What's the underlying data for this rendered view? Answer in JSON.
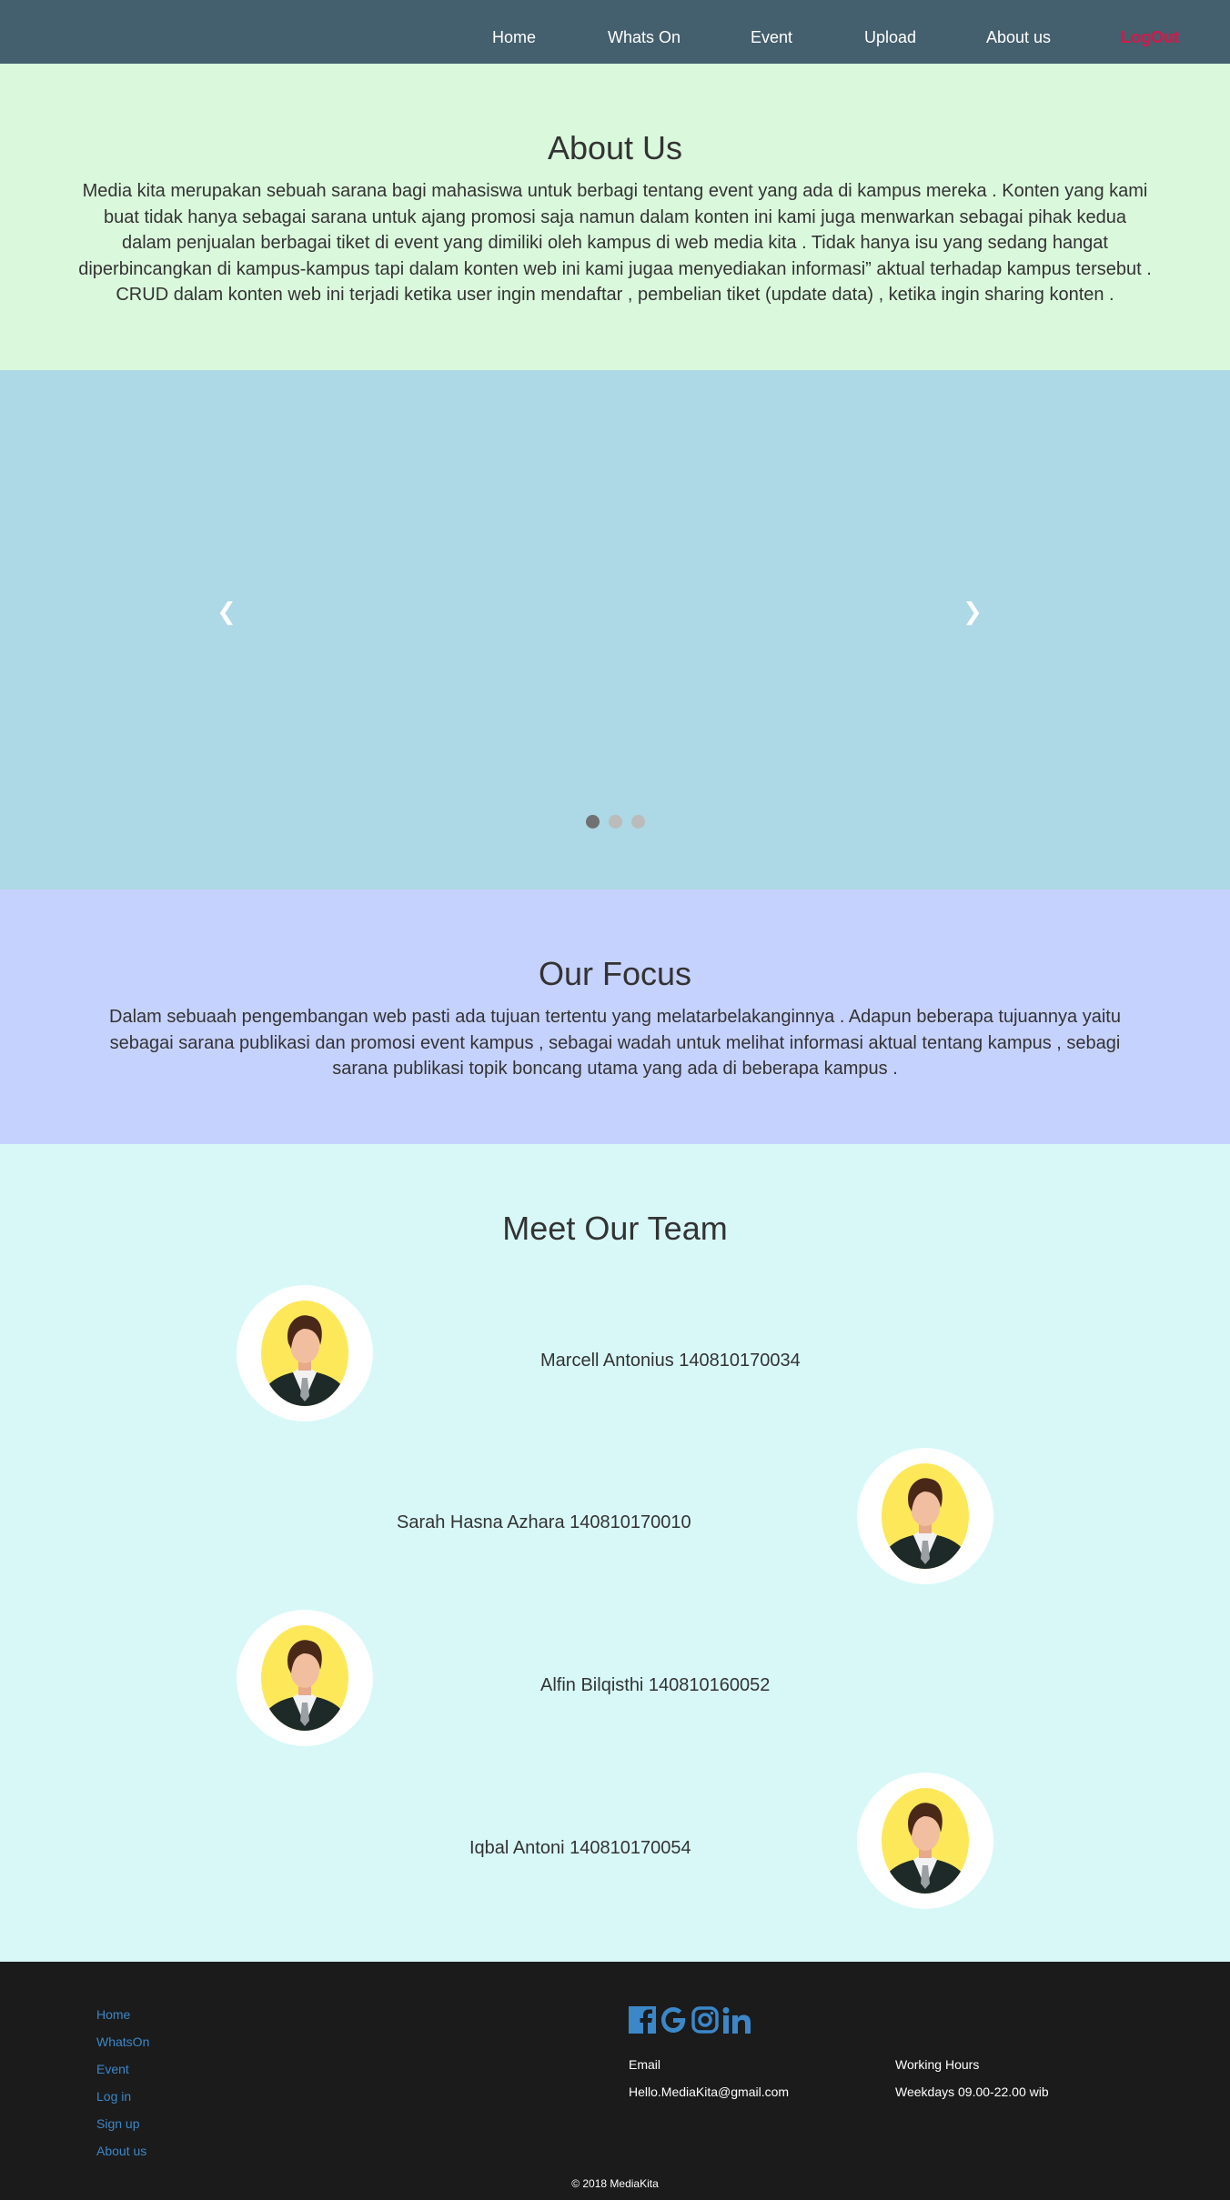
{
  "nav": {
    "home": "Home",
    "whats_on": "Whats On",
    "event": "Event",
    "upload": "Upload",
    "about": "About us",
    "logout": "LogOut"
  },
  "about": {
    "title": "About Us",
    "text": "Media kita merupakan sebuah sarana bagi mahasiswa untuk berbagi tentang event yang ada di kampus mereka . Konten yang kami buat tidak hanya sebagai sarana untuk ajang promosi saja namun dalam konten ini kami juga menwarkan sebagai pihak kedua dalam penjualan berbagai tiket di event yang dimiliki oleh kampus di web media kita . Tidak hanya isu yang sedang hangat diperbincangkan di kampus-kampus tapi dalam konten web ini kami jugaa menyediakan informasi” aktual terhadap kampus tersebut . CRUD dalam konten web ini terjadi ketika user ingin mendaftar , pembelian tiket (update data) , ketika ingin sharing konten ."
  },
  "slider": {
    "prev": "❮",
    "next": "❯",
    "slide_count": 3,
    "active_index": 0
  },
  "focus": {
    "title": "Our Focus",
    "text": "Dalam sebuaah pengembangan web pasti ada tujuan tertentu yang melatarbelakanginnya . Adapun beberapa tujuannya yaitu sebagai sarana publikasi dan promosi event kampus , sebagai wadah untuk melihat informasi aktual tentang kampus , sebagi sarana publikasi topik boncang utama yang ada di beberapa kampus ."
  },
  "team": {
    "title": "Meet Our Team",
    "members": [
      {
        "name": "Marcell Antonius 140810170034"
      },
      {
        "name": "Sarah Hasna Azhara 140810170010"
      },
      {
        "name": "Alfin Bilqisthi 140810160052"
      },
      {
        "name": "Iqbal Antoni 140810170054"
      }
    ]
  },
  "footer": {
    "links": [
      "Home",
      "WhatsOn",
      "Event",
      "Log in",
      "Sign up",
      "About us"
    ],
    "social_icons": [
      "facebook-icon",
      "google-icon",
      "instagram-icon",
      "linkedin-icon"
    ],
    "email_label": "Email",
    "email_value": "Hello.MediaKita@gmail.com",
    "hours_label": "Working Hours",
    "hours_value": "Weekdays 09.00-22.00 wib",
    "copyright": "© 2018 MediaKita"
  },
  "colors": {
    "nav_bg": "#445f6d",
    "logout": "#d5184b",
    "about_bg": "#daf8dc",
    "slider_bg": "#add8e5",
    "focus_bg": "#c6d2fe",
    "team_bg": "#d8f8f8",
    "footer_bg": "#1b1b1b",
    "footer_link": "#3b87c8",
    "avatar_yellow": "#fde85a"
  }
}
